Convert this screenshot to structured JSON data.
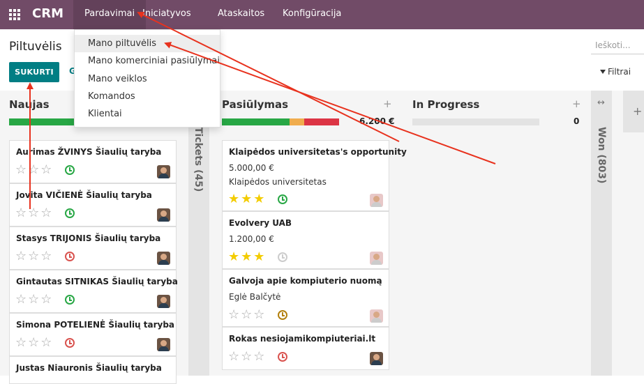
{
  "navbar": {
    "brand": "CRM",
    "menus": [
      {
        "label": "Pardavimai"
      },
      {
        "label": "Iniciatyvos"
      },
      {
        "label": "Ataskaitos"
      },
      {
        "label": "Konfigūracija"
      }
    ]
  },
  "dropdown": {
    "items": [
      {
        "label": "Mano piltuvėlis"
      },
      {
        "label": "Mano komerciniai pasiūlymai"
      },
      {
        "label": "Mano veiklos"
      },
      {
        "label": "Komandos"
      },
      {
        "label": "Klientai"
      }
    ]
  },
  "control_panel": {
    "title": "Piltuvėlis",
    "search_placeholder": "Ieškoti...",
    "create_label": "SUKURTI",
    "g_label": "G",
    "filters_label": "Filtrai"
  },
  "columns": {
    "naujas": {
      "title": "Naujas",
      "cards": [
        {
          "title": "Aurimas ŽVINYS Šiaulių taryba",
          "stars": 0,
          "activity": "green"
        },
        {
          "title": "Jovita VIČIENĖ Šiaulių taryba",
          "stars": 0,
          "activity": "green"
        },
        {
          "title": "Stasys TRIJONIS Šiaulių taryba",
          "stars": 0,
          "activity": "red"
        },
        {
          "title": "Gintautas SITNIKAS Šiaulių taryba",
          "stars": 0,
          "activity": "green"
        },
        {
          "title": "Simona POTELIENĖ Šiaulių taryba",
          "stars": 0,
          "activity": "red"
        },
        {
          "title": "Justas Niauronis Šiaulių taryba"
        }
      ]
    },
    "tickets": {
      "label": "Tickets (45)"
    },
    "pasiulymas": {
      "title": "Pasiūlymas",
      "plus": "+",
      "total": "6.200 €",
      "progress": {
        "green": 0.58,
        "orange": 0.12,
        "red": 0.3
      },
      "cards": [
        {
          "title": "Klaipėdos universitetas's opportunity",
          "amount": "5.000,00 €",
          "partner": "Klaipėdos universitetas",
          "stars": 3,
          "activity": "green"
        },
        {
          "title": "Evolvery UAB",
          "amount": "1.200,00 €",
          "stars": 3,
          "activity": "gray"
        },
        {
          "title": "Galvoja apie kompiuterio nuomą",
          "partner": "Eglė Balčytė",
          "stars": 0,
          "activity": "orange"
        },
        {
          "title": "Rokas nesiojamikompiuteriai.lt",
          "stars": 0,
          "activity": "red"
        }
      ]
    },
    "in_progress": {
      "title": "In Progress",
      "plus": "+",
      "total": "0"
    },
    "won": {
      "label": "Won (803)",
      "icon": "↔"
    },
    "extra_plus": "+"
  },
  "colors": {
    "navbar": "#714b67",
    "primary": "#017e84",
    "progress_green": "#28a745",
    "progress_orange": "#f0ad4e",
    "progress_red": "#dc3545",
    "annotation_arrow": "#e8321e"
  }
}
